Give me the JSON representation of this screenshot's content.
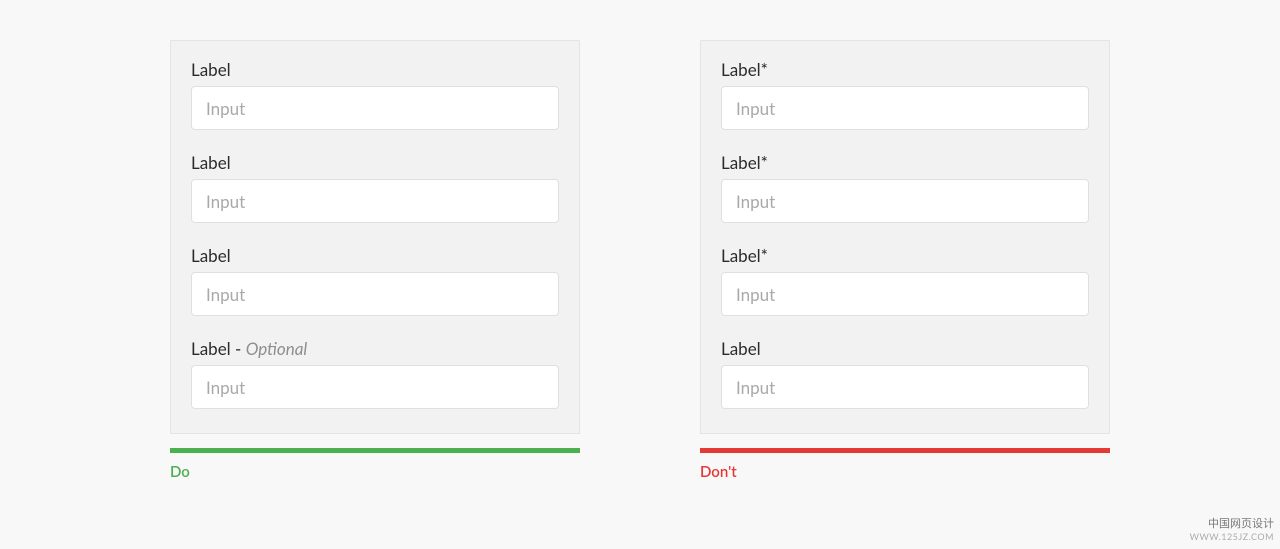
{
  "do_panel": {
    "fields": [
      {
        "label": "Label",
        "optional": "",
        "placeholder": "Input"
      },
      {
        "label": "Label",
        "optional": "",
        "placeholder": "Input"
      },
      {
        "label": "Label",
        "optional": "",
        "placeholder": "Input"
      },
      {
        "label": "Label - ",
        "optional": "Optional",
        "placeholder": "Input"
      }
    ],
    "caption": "Do"
  },
  "dont_panel": {
    "fields": [
      {
        "label": "Label*",
        "placeholder": "Input"
      },
      {
        "label": "Label*",
        "placeholder": "Input"
      },
      {
        "label": "Label*",
        "placeholder": "Input"
      },
      {
        "label": "Label",
        "placeholder": "Input"
      }
    ],
    "caption": "Don't"
  },
  "watermark": {
    "line1": "中国网页设计",
    "line2": "WWW.125JZ.COM"
  },
  "colors": {
    "do": "#4caf50",
    "dont": "#e53935"
  }
}
